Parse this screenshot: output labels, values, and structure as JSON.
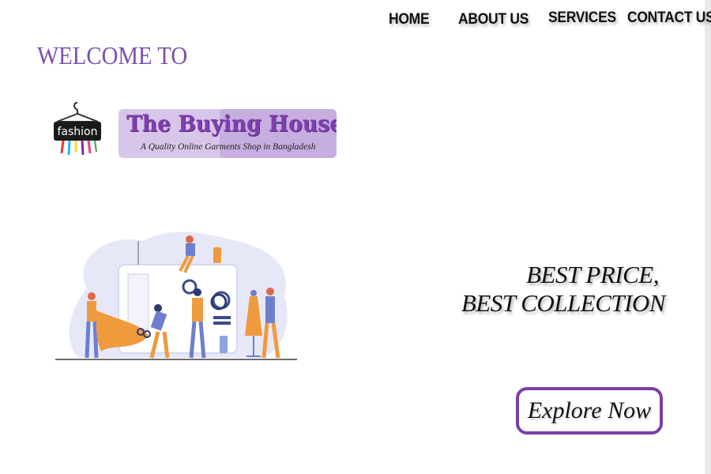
{
  "nav": {
    "home": "HOME",
    "about": "ABOUT US",
    "services": "SERVICES",
    "contact": "CONTACT US"
  },
  "welcome": "WELCOME TO",
  "logo": {
    "icon_text": "fashion",
    "title": "The Buying House",
    "tagline": "A Quality Online Garments Shop in Bangladesh"
  },
  "hero": {
    "line1": "BEST PRICE,",
    "line2": "BEST COLLECTION"
  },
  "cta": {
    "label": "Explore Now"
  },
  "colors": {
    "accent": "#7b4fb6",
    "button_border": "#7b3fa8",
    "illustration_orange": "#f09a3e",
    "illustration_blue": "#6d7fcc"
  }
}
